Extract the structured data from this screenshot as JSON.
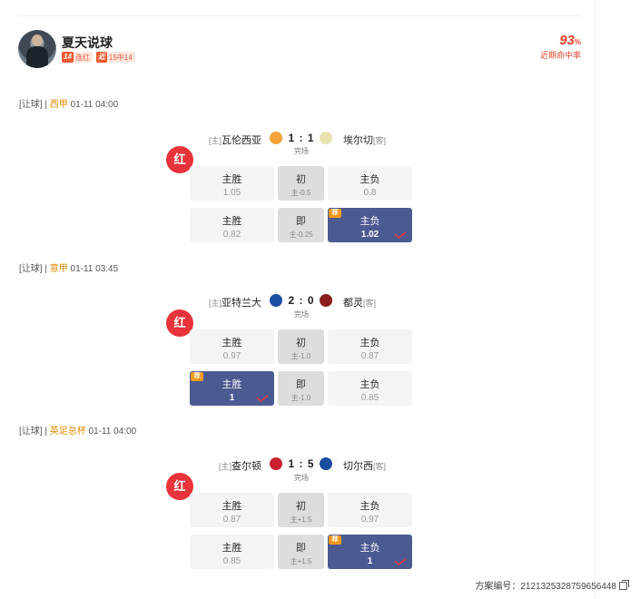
{
  "expert": {
    "name": "夏天说球",
    "streak_badge_key": "14",
    "streak_badge_text": "连红",
    "recent_badge_key": "近",
    "recent_badge_text": "15中14",
    "hit_rate": "93",
    "hit_rate_unit": "%",
    "hit_rate_label": "近期命中率"
  },
  "matches": [
    {
      "type": "[让球]",
      "sep": "|",
      "league": "西甲",
      "time": "01-11 04:00",
      "home_tag": "[主]",
      "home": "瓦伦西亚",
      "score": "1 : 1",
      "away": "埃尔切",
      "away_tag": "[客]",
      "state": "完场",
      "stamp": "红",
      "home_logo_color": "#f2a23a",
      "away_logo_color": "#e8e3b0",
      "initial": {
        "left_label": "主胜",
        "left_val": "1.05",
        "mid_label": "初",
        "mid_val": "主-0.5",
        "right_label": "主负",
        "right_val": "0.8"
      },
      "live": {
        "left_label": "主胜",
        "left_val": "0.82",
        "mid_label": "即",
        "mid_val": "主-0.25",
        "right_label": "主负",
        "right_val": "1.02"
      },
      "selected": "right",
      "rec_label": "荐"
    },
    {
      "type": "[让球]",
      "sep": "|",
      "league": "意甲",
      "time": "01-11 03:45",
      "home_tag": "[主]",
      "home": "亚特兰大",
      "score": "2 : 0",
      "away": "都灵",
      "away_tag": "[客]",
      "state": "完场",
      "stamp": "红",
      "home_logo_color": "#1d4fa3",
      "away_logo_color": "#8a1e1e",
      "initial": {
        "left_label": "主胜",
        "left_val": "0.97",
        "mid_label": "初",
        "mid_val": "主-1.0",
        "right_label": "主负",
        "right_val": "0.87"
      },
      "live": {
        "left_label": "主胜",
        "left_val": "1",
        "mid_label": "即",
        "mid_val": "主-1.0",
        "right_label": "主负",
        "right_val": "0.85"
      },
      "selected": "left",
      "rec_label": "荐"
    },
    {
      "type": "[让球]",
      "sep": "|",
      "league": "英足总杯",
      "time": "01-11 04:00",
      "home_tag": "[主]",
      "home": "查尔顿",
      "score": "1 : 5",
      "away": "切尔西",
      "away_tag": "[客]",
      "state": "完场",
      "stamp": "红",
      "home_logo_color": "#c8202f",
      "away_logo_color": "#1b4ea1",
      "initial": {
        "left_label": "主胜",
        "left_val": "0.87",
        "mid_label": "初",
        "mid_val": "主+1.5",
        "right_label": "主负",
        "right_val": "0.97"
      },
      "live": {
        "left_label": "主胜",
        "left_val": "0.85",
        "mid_label": "即",
        "mid_val": "主+1.5",
        "right_label": "主负",
        "right_val": "1"
      },
      "selected": "right",
      "rec_label": "荐"
    }
  ],
  "plan_code_label": "方案编号：",
  "plan_code": "2121325328759656448"
}
